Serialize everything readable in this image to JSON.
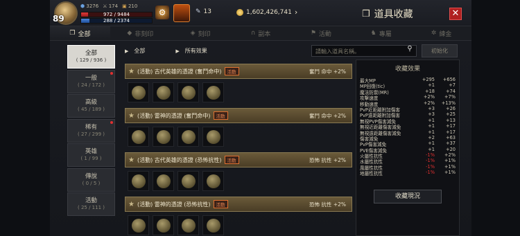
{
  "player": {
    "level": "89",
    "stat_a": "3276",
    "stat_b": "174",
    "stat_c": "210",
    "hp": "972 / 9484",
    "hp_fraction": 0.1,
    "mp": "288 / 2374",
    "mp_fraction": 0.12
  },
  "currency": {
    "silver": "13",
    "gold": "1,602,426,741"
  },
  "header": {
    "title": "道具收藏",
    "close_label": "✕"
  },
  "tabs": [
    {
      "label": "全部",
      "icon": "book-icon",
      "glyph": "❐"
    },
    {
      "label": "非刻印",
      "icon": "gem-icon",
      "glyph": "◆"
    },
    {
      "label": "刻印",
      "icon": "stamp-icon",
      "glyph": "◈"
    },
    {
      "label": "副本",
      "icon": "helmet-icon",
      "glyph": "∩"
    },
    {
      "label": "活動",
      "icon": "flag-icon",
      "glyph": "⚑"
    },
    {
      "label": "專屬",
      "icon": "horse-icon",
      "glyph": "♞"
    },
    {
      "label": "練金",
      "icon": "gear-icon",
      "glyph": "✲"
    }
  ],
  "categories": [
    {
      "label": "全部",
      "count": "( 129 / 936 )",
      "new": false
    },
    {
      "label": "一般",
      "count": "( 24 / 172 )",
      "new": true
    },
    {
      "label": "高級",
      "count": "( 45 / 189 )",
      "new": false
    },
    {
      "label": "稀有",
      "count": "( 27 / 299 )",
      "new": true
    },
    {
      "label": "英雄",
      "count": "( 1 / 99 )",
      "new": false
    },
    {
      "label": "傳說",
      "count": "( 0 / 5 )",
      "new": false
    },
    {
      "label": "活動",
      "count": "( 25 / 111 )",
      "new": false
    }
  ],
  "filter": {
    "crumb1": "全部",
    "crumb2": "所有效果",
    "search_placeholder": "請輸入道具名稱。",
    "reset_label": "初始化"
  },
  "groups": [
    {
      "name": "(活動) 古代英雄的憑證 (奮鬥命中)",
      "tag": "活動",
      "effect": "奮鬥 命中 +2%"
    },
    {
      "name": "(活動) 雷神的憑證 (奮鬥命中)",
      "tag": "活動",
      "effect": "奮鬥 命中 +2%"
    },
    {
      "name": "(活動) 古代英雄的憑證 (恐怖抗性)",
      "tag": "活動",
      "effect": "恐怖 抗性 +2%"
    },
    {
      "name": "(活動) 雷神的憑證 (恐怖抗性)",
      "tag": "活動",
      "effect": "恐怖 抗性 +2%"
    }
  ],
  "effects_panel": {
    "title": "收藏效果",
    "rows": [
      {
        "name": "最大MP",
        "v1": "+295",
        "v2": "+656",
        "neg": false
      },
      {
        "name": "MP回復(tic)",
        "v1": "+1",
        "v2": "+7",
        "neg": false
      },
      {
        "name": "魔法防禦(MR)",
        "v1": "+18",
        "v2": "+74",
        "neg": false
      },
      {
        "name": "攻擊速度",
        "v1": "+2%",
        "v2": "+7%",
        "neg": false
      },
      {
        "name": "移動速度",
        "v1": "+2%",
        "v2": "+13%",
        "neg": false
      },
      {
        "name": "PvP近距離附加傷害",
        "v1": "+3",
        "v2": "+26",
        "neg": false
      },
      {
        "name": "PvP遠距離附加傷害",
        "v1": "+3",
        "v2": "+25",
        "neg": false
      },
      {
        "name": "無視PVP傷害減免",
        "v1": "+1",
        "v2": "+13",
        "neg": false
      },
      {
        "name": "無視近距離傷害減免",
        "v1": "+1",
        "v2": "+17",
        "neg": false
      },
      {
        "name": "無視遠距離傷害減免",
        "v1": "+1",
        "v2": "+17",
        "neg": false
      },
      {
        "name": "傷害減免",
        "v1": "+2",
        "v2": "+63",
        "neg": false
      },
      {
        "name": "PvP傷害減免",
        "v1": "+1",
        "v2": "+37",
        "neg": false
      },
      {
        "name": "PVE傷害減免",
        "v1": "+1",
        "v2": "+20",
        "neg": false
      },
      {
        "name": "火屬性抗性",
        "v1": "-1%",
        "v2": "+2%",
        "neg": true
      },
      {
        "name": "水屬性抗性",
        "v1": "-1%",
        "v2": "+1%",
        "neg": true
      },
      {
        "name": "風屬性抗性",
        "v1": "-1%",
        "v2": "+1%",
        "neg": true
      },
      {
        "name": "地屬性抗性",
        "v1": "-1%",
        "v2": "+1%",
        "neg": true
      }
    ],
    "button_label": "收藏現況"
  }
}
